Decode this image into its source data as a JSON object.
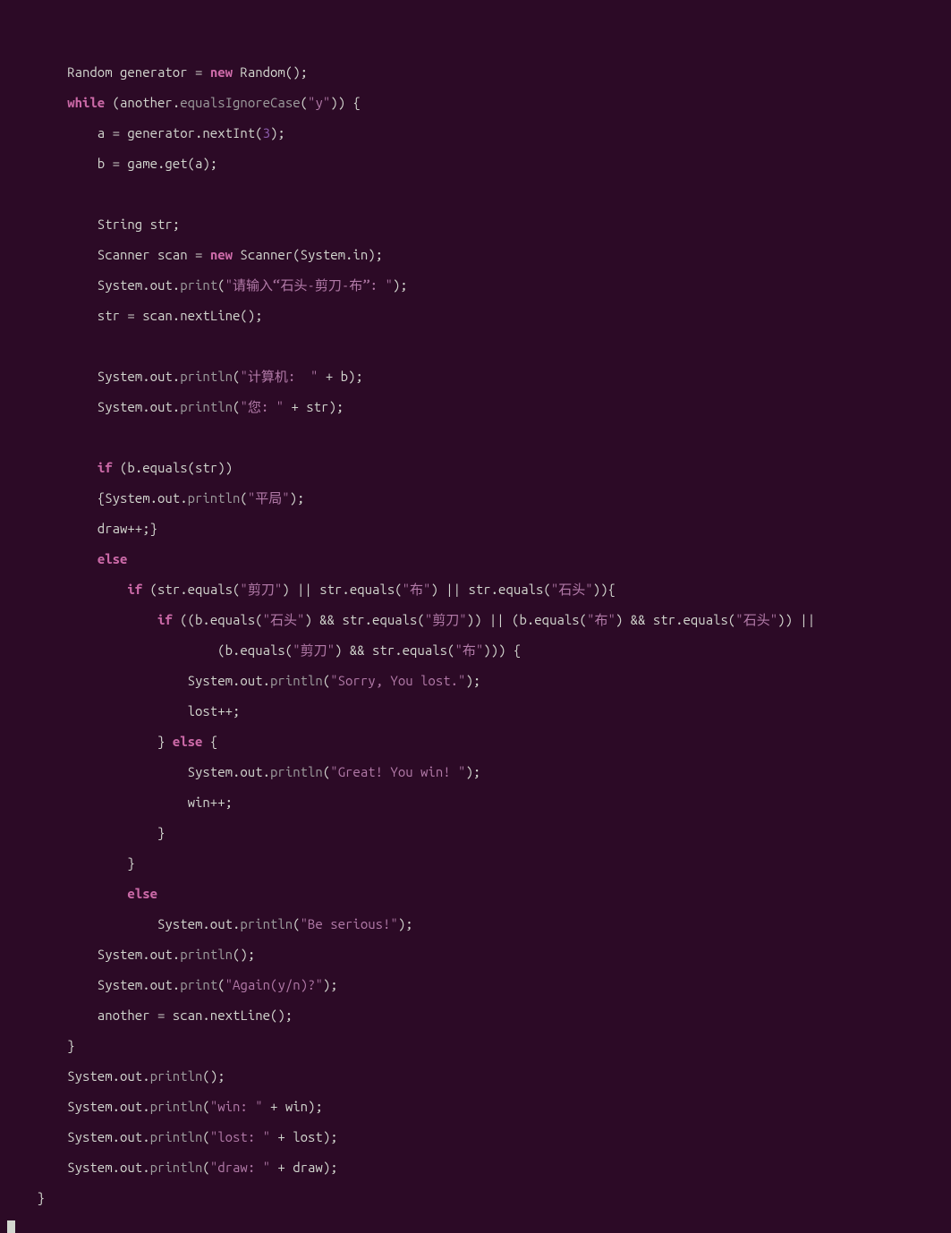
{
  "code": {
    "indent": "        ",
    "lines": [
      {
        "raw": "Random generator = ",
        "kw": "new",
        "after": " Random();",
        "pre": 0
      },
      {
        "kw": "while",
        "after": " (another.",
        "m": "equalsIgnoreCase",
        "r2": "(",
        "s": "\"y\"",
        "r3": ")) {",
        "pre": 0
      },
      {
        "raw": "    a = generator.nextInt(",
        "num": "3",
        "after": ");",
        "pre": 0
      },
      {
        "raw": "    b = game.get(a);",
        "pre": 0
      },
      {
        "raw": "",
        "pre": 0,
        "blank": true
      },
      {
        "raw": "    String str;",
        "pre": 0
      },
      {
        "raw": "    Scanner scan = ",
        "kw": "new",
        "after": " Scanner(System.in);",
        "pre": 0
      },
      {
        "raw": "    System.out.",
        "m": "print",
        "r1": "(",
        "s": "\"请输入“石头-剪刀-布”: \"",
        "r3": ");",
        "pre": 0
      },
      {
        "raw": "    str = scan.nextLine();",
        "pre": 0
      },
      {
        "raw": "",
        "pre": 0,
        "blank": true
      },
      {
        "raw": "    System.out.",
        "m": "println",
        "r1": "(",
        "s": "\"计算机:  \"",
        "r2": " + b);",
        "pre": 0
      },
      {
        "raw": "    System.out.",
        "m": "println",
        "r1": "(",
        "s": "\"您: \"",
        "r2": " + str);",
        "pre": 0
      },
      {
        "raw": "",
        "pre": 0,
        "blank": true
      },
      {
        "raw": "    ",
        "kw": "if",
        "after": " (b.equals(str))",
        "pre": 0
      },
      {
        "raw": "    {System.out.",
        "m": "println",
        "r1": "(",
        "s": "\"平局\"",
        "r3": ");",
        "pre": 0
      },
      {
        "raw": "    draw++;}",
        "pre": 0
      },
      {
        "raw": "    ",
        "kw": "else",
        "pre": 0
      },
      {
        "segments": [
          {
            "t": "        ",
            "c": ""
          },
          {
            "t": "if",
            "c": "kw"
          },
          {
            "t": " (str.equals(",
            "c": ""
          },
          {
            "t": "\"剪刀\"",
            "c": "str"
          },
          {
            "t": ") || str.equals(",
            "c": ""
          },
          {
            "t": "\"布\"",
            "c": "str"
          },
          {
            "t": ") || str.equals(",
            "c": ""
          },
          {
            "t": "\"石头\"",
            "c": "str"
          },
          {
            "t": ")){",
            "c": ""
          }
        ]
      },
      {
        "segments": [
          {
            "t": "            ",
            "c": ""
          },
          {
            "t": "if",
            "c": "kw"
          },
          {
            "t": " ((b.equals(",
            "c": ""
          },
          {
            "t": "\"石头\"",
            "c": "str"
          },
          {
            "t": ") && str.equals(",
            "c": ""
          },
          {
            "t": "\"剪刀\"",
            "c": "str"
          },
          {
            "t": ")) || (b.equals(",
            "c": ""
          },
          {
            "t": "\"布\"",
            "c": "str"
          },
          {
            "t": ") && str.equals(",
            "c": ""
          },
          {
            "t": "\"石头\"",
            "c": "str"
          },
          {
            "t": ")) ||",
            "c": ""
          }
        ]
      },
      {
        "segments": [
          {
            "t": "                    (b.equals(",
            "c": ""
          },
          {
            "t": "\"剪刀\"",
            "c": "str"
          },
          {
            "t": ") && str.equals(",
            "c": ""
          },
          {
            "t": "\"布\"",
            "c": "str"
          },
          {
            "t": "))) {",
            "c": ""
          }
        ]
      },
      {
        "raw": "                System.out.",
        "m": "println",
        "r1": "(",
        "s": "\"Sorry, You lost.\"",
        "r3": ");",
        "pre": 0
      },
      {
        "raw": "                lost++;",
        "pre": 0
      },
      {
        "segments": [
          {
            "t": "            } ",
            "c": ""
          },
          {
            "t": "else",
            "c": "kw"
          },
          {
            "t": " {",
            "c": ""
          }
        ]
      },
      {
        "raw": "                System.out.",
        "m": "println",
        "r1": "(",
        "s": "\"Great! You win! \"",
        "r3": ");",
        "pre": 0
      },
      {
        "raw": "                win++;",
        "pre": 0
      },
      {
        "raw": "            }",
        "pre": 0
      },
      {
        "raw": "        }",
        "pre": 0
      },
      {
        "raw": "        ",
        "kw": "else",
        "pre": 0
      },
      {
        "raw": "            System.out.",
        "m": "println",
        "r1": "(",
        "s": "\"Be serious!\"",
        "r3": ");",
        "pre": 0
      },
      {
        "raw": "    System.out.",
        "m": "println",
        "r1": "();",
        "pre": 0
      },
      {
        "raw": "    System.out.",
        "m": "print",
        "r1": "(",
        "s": "\"Again(y/n)?\"",
        "r3": ");",
        "pre": 0
      },
      {
        "raw": "    another = scan.nextLine();",
        "pre": 0
      },
      {
        "raw": "}",
        "pre": 0
      },
      {
        "raw": "System.out.",
        "m": "println",
        "r1": "();",
        "pre": 0
      },
      {
        "raw": "System.out.",
        "m": "println",
        "r1": "(",
        "s": "\"win: \"",
        "r2": " + win);",
        "pre": 0
      },
      {
        "raw": "System.out.",
        "m": "println",
        "r1": "(",
        "s": "\"lost: \"",
        "r2": " + lost);",
        "pre": 0
      },
      {
        "raw": "System.out.",
        "m": "println",
        "r1": "(",
        "s": "\"draw: \"",
        "r2": " + draw);",
        "pre": 0
      }
    ],
    "closing_brace_indent": "    ",
    "closing_brace": "}"
  }
}
